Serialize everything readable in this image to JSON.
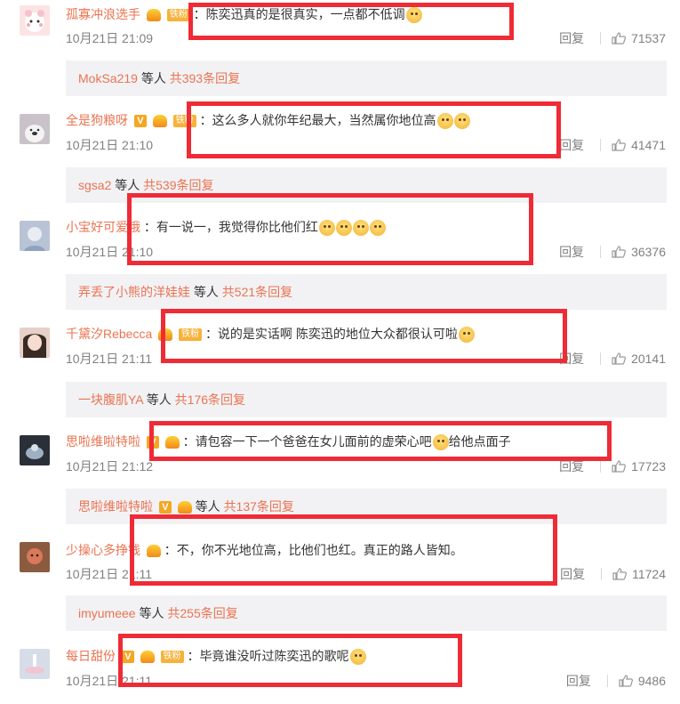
{
  "comments": [
    {
      "username": "孤寡冲浪选手",
      "badges": [
        "crown",
        "ironfan"
      ],
      "text": "：陈奕迅真的是很真实，一点都不低调",
      "emoji": 1,
      "date": "10月21日 21:09",
      "reply_label": "回复",
      "likes": "71537"
    },
    {
      "username": "全是狗粮呀",
      "badges": [
        "vip",
        "crown",
        "ironfan"
      ],
      "text": "：这么多人就你年纪最大，当然属你地位高",
      "emoji": 2,
      "date": "10月21日 21:10",
      "reply_label": "回复",
      "likes": "41471"
    },
    {
      "username": "小宝好可爱哦",
      "badges": [],
      "text": "：有一说一，我觉得你比他们红",
      "emoji": 4,
      "date": "10月21日 21:10",
      "reply_label": "回复",
      "likes": "36376"
    },
    {
      "username": "千黛汐Rebecca",
      "badges": [
        "crown",
        "ironfan"
      ],
      "text": "：说的是实话啊 陈奕迅的地位大众都很认可啦",
      "emoji": 1,
      "date": "10月21日 21:11",
      "reply_label": "回复",
      "likes": "20141"
    },
    {
      "username": "思啦维啦特啦",
      "badges": [
        "vip",
        "crown"
      ],
      "text": "：请包容一下一个爸爸在女儿面前的虚荣心吧",
      "emoji": 1,
      "text_after": "给他点面子",
      "date": "10月21日 21:12",
      "reply_label": "回复",
      "likes": "17723"
    },
    {
      "username": "少操心多挣钱",
      "badges": [
        "crown"
      ],
      "text": "：不，你不光地位高，比他们也红。真正的路人皆知。",
      "emoji": 0,
      "date": "10月21日 21:11",
      "reply_label": "回复",
      "likes": "11724"
    },
    {
      "username": "每日甜份",
      "badges": [
        "vip",
        "crown",
        "ironfan"
      ],
      "text": "：毕竟谁没听过陈奕迅的歌呢",
      "emoji": 1,
      "date": "10月21日 21:11",
      "reply_label": "回复",
      "likes": "9486"
    }
  ],
  "reply_bars": [
    {
      "name": "MokSa219",
      "mid": " 等人 ",
      "count": "共393条回复"
    },
    {
      "name": "sgsa2",
      "mid": " 等人 ",
      "count": "共539条回复"
    },
    {
      "name": "弄丢了小熊的洋娃娃",
      "mid": " 等人 ",
      "count": "共521条回复"
    },
    {
      "name": "一块腹肌YA",
      "mid": " 等人 ",
      "count": "共176条回复"
    },
    {
      "name": "思啦维啦特啦",
      "mid": " 等人 ",
      "count": "共137条回复"
    },
    {
      "name": "imyumeee",
      "mid": " 等人 ",
      "count": "共255条回复"
    }
  ],
  "badge_text": {
    "ironfan": "铁粉",
    "vip": "V"
  },
  "colors": {
    "username": "#eb7350",
    "highlight_box": "#ef2b36",
    "reply_bar_bg": "#f2f2f5"
  }
}
